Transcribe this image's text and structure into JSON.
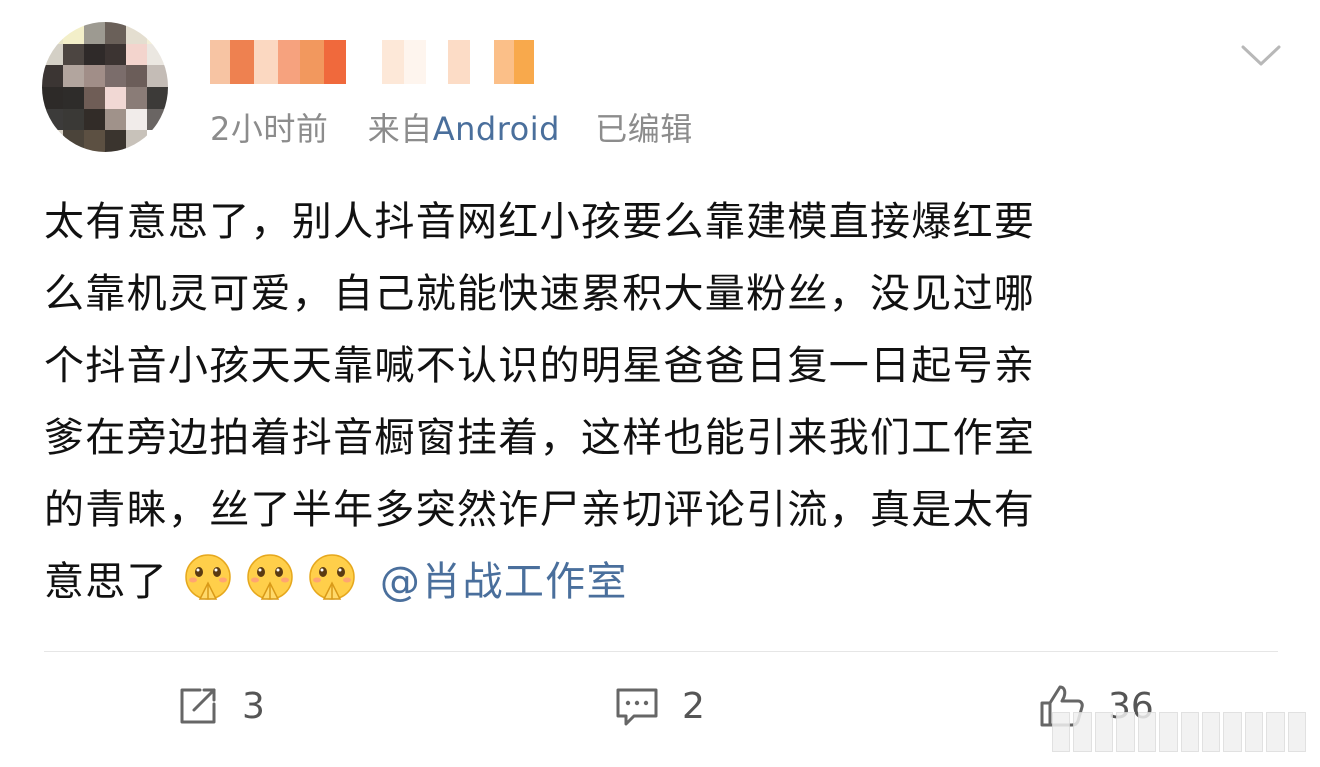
{
  "post": {
    "author_name": "",
    "time": "2小时前",
    "from_prefix": "来自",
    "source": "Android",
    "edited": "已编辑",
    "content_lines": [
      "太有意思了，别人抖音网红小孩要么靠建模直接爆红要",
      "么靠机灵可爱，自己就能快速累积大量粉丝，没见过哪",
      "个抖音小孩天天靠喊不认识的明星爸爸日复一日起号亲",
      "爹在旁边拍着抖音橱窗挂着，这样也能引来我们工作室",
      "的青睐，丝了半年多突然诈尸亲切评论引流，真是太有"
    ],
    "last_line_text": "意思了",
    "emojis": [
      "pray-emoji",
      "pray-emoji",
      "pray-emoji"
    ],
    "mention": "@肖战工作室"
  },
  "actions": {
    "repost_count": "3",
    "comment_count": "2",
    "like_count": "36"
  },
  "icons": {
    "avatar": "avatar",
    "menu": "chevron-down-icon",
    "repost": "repost-icon",
    "comment": "comment-icon",
    "like": "thumbs-up-icon"
  },
  "colors": {
    "link": "#4a6f9c",
    "meta": "#8c8c8c",
    "text": "#111111",
    "divider": "#e6e6e6",
    "username_blur": "#f0803c"
  }
}
